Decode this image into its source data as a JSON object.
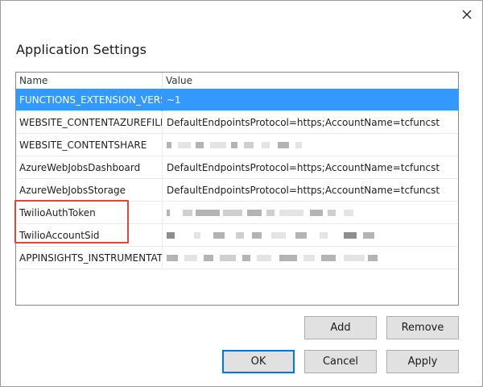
{
  "dialog": {
    "title": "Application Settings"
  },
  "grid": {
    "columns": [
      "Name",
      "Value"
    ],
    "rows": [
      {
        "name": "FUNCTIONS_EXTENSION_VERSION",
        "value": "~1",
        "masked": false,
        "selected": true
      },
      {
        "name": "WEBSITE_CONTENTAZUREFILECONNECTIONSTRING",
        "value": "DefaultEndpointsProtocol=https;AccountName=tcfuncst",
        "masked": false,
        "selected": false
      },
      {
        "name": "WEBSITE_CONTENTSHARE",
        "value": "",
        "masked": true,
        "selected": false
      },
      {
        "name": "AzureWebJobsDashboard",
        "value": "DefaultEndpointsProtocol=https;AccountName=tcfuncst",
        "masked": false,
        "selected": false
      },
      {
        "name": "AzureWebJobsStorage",
        "value": "DefaultEndpointsProtocol=https;AccountName=tcfuncst",
        "masked": false,
        "selected": false
      },
      {
        "name": "TwilioAuthToken",
        "value": "",
        "masked": true,
        "selected": false
      },
      {
        "name": "TwilioAccountSid",
        "value": "",
        "masked": true,
        "selected": false
      },
      {
        "name": "APPINSIGHTS_INSTRUMENTATIONKEY",
        "value": "",
        "masked": true,
        "selected": false
      }
    ]
  },
  "buttons": {
    "add": "Add",
    "remove": "Remove",
    "ok": "OK",
    "cancel": "Cancel",
    "apply": "Apply"
  },
  "colors": {
    "selection": "#3399ff",
    "highlight": "#e0463c"
  },
  "icons": {
    "close": "close-icon"
  }
}
